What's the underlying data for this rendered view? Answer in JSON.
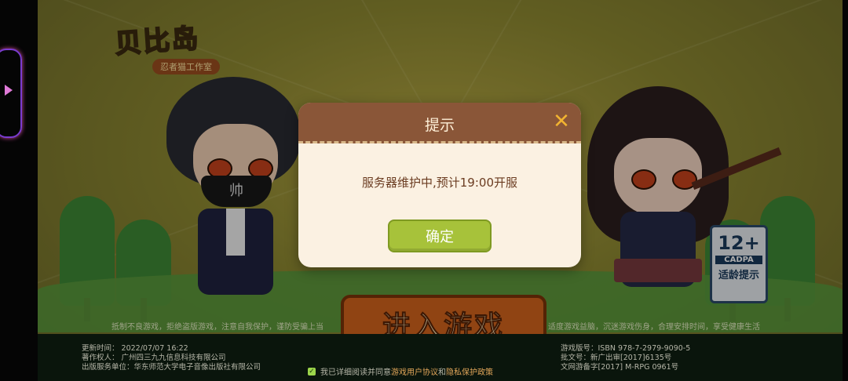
{
  "game": {
    "logo_text": "贝比岛",
    "logo_sub": "忍者猫工作室",
    "enter_label": "进入游戏",
    "boy_mask_text": "帅",
    "age_badge": {
      "rating": "12+",
      "org": "CADPA",
      "label": "适龄提示"
    }
  },
  "slogans": {
    "left": "抵制不良游戏，拒绝盗版游戏，注意自我保护，谨防受骗上当",
    "right": "适度游戏益脑，沉迷游戏伤身，合理安排时间，享受健康生活"
  },
  "footer": {
    "update_time": "更新时间： 2022/07/07 16:22",
    "copyright": "著作权人： 广州四三九九信息科技有限公司",
    "publisher": "出版服务单位：华东师范大学电子音像出版社有限公司",
    "isbn": "游戏版号：ISBN 978-7-2979-9090-5",
    "approval": "批文号：新广出审[2017]6135号",
    "culture_record": "文网游备字[2017] M-RPG 0961号",
    "agree_prefix": "我已详细阅读并同意",
    "user_agreement": "游戏用户协议",
    "and": "和",
    "privacy_policy": "隐私保护政策"
  },
  "dialog": {
    "title": "提示",
    "message": "服务器维护中,预计19:00开服",
    "confirm_label": "确定"
  },
  "colors": {
    "dialog_header": "#8a5638",
    "dialog_body": "#fbf1e2",
    "confirm_button": "#a7c23a",
    "close_icon": "#f2b431"
  },
  "icons": {
    "close": "close-icon",
    "checkbox": "checkbox-checked-icon"
  }
}
